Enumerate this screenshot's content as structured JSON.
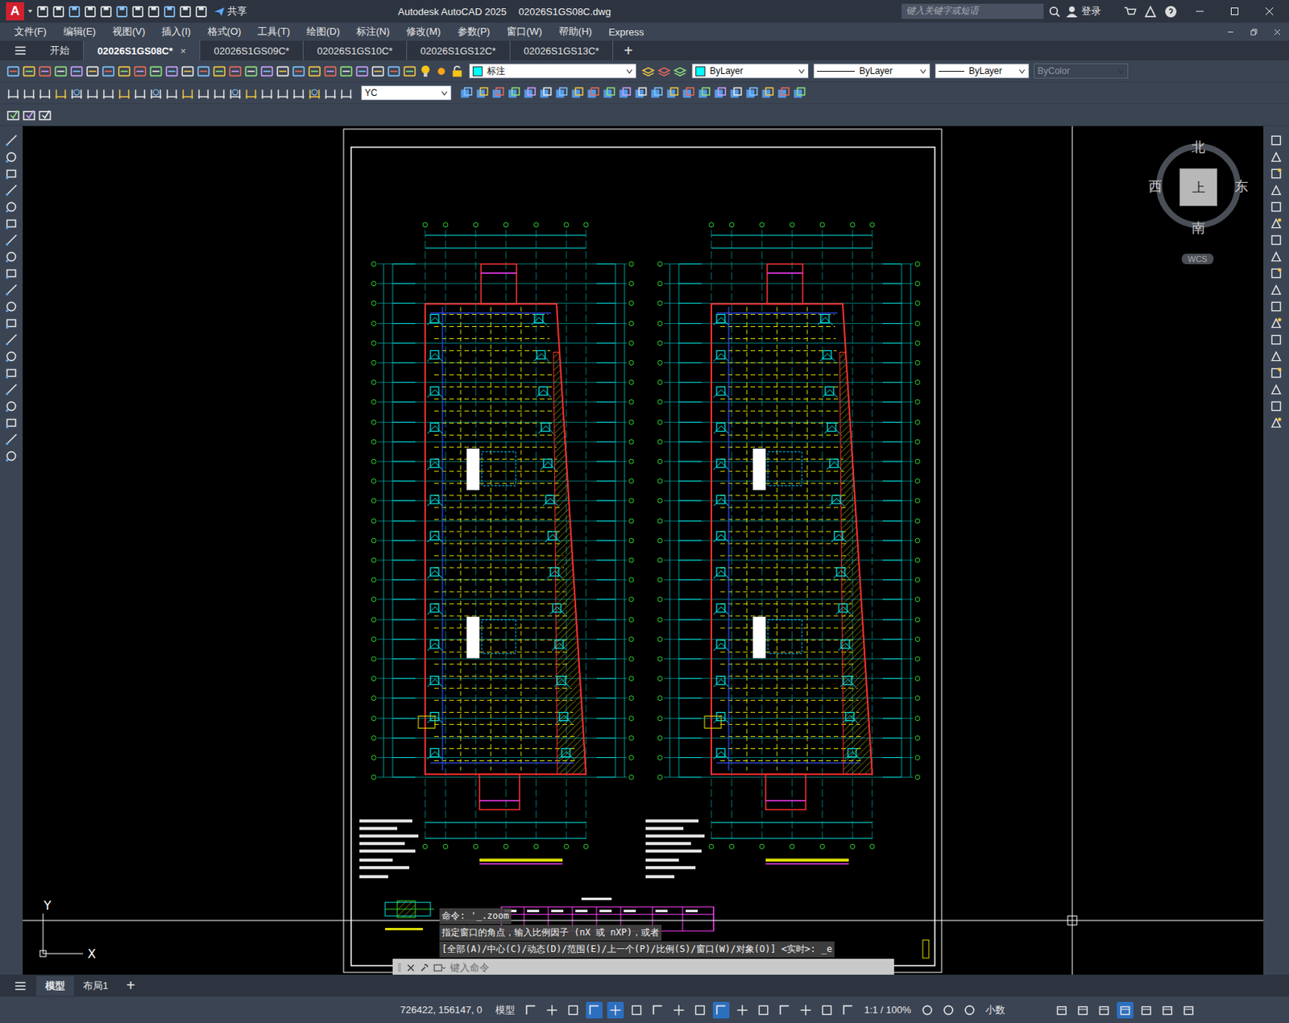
{
  "window": {
    "app_letter": "A",
    "share": "共享",
    "app_name": "Autodesk AutoCAD 2025",
    "file_name": "02026S1GS08C.dwg",
    "search_placeholder": "键入关键字或短语",
    "login": "登录"
  },
  "menu": [
    "文件(F)",
    "编辑(E)",
    "视图(V)",
    "插入(I)",
    "格式(O)",
    "工具(T)",
    "绘图(D)",
    "标注(N)",
    "修改(M)",
    "参数(P)",
    "窗口(W)",
    "帮助(H)",
    "Express"
  ],
  "file_tabs": [
    {
      "label": "开始",
      "selected": false
    },
    {
      "label": "02026S1GS08C*",
      "selected": true
    },
    {
      "label": "02026S1GS09C*",
      "selected": false
    },
    {
      "label": "02026S1GS10C*",
      "selected": false
    },
    {
      "label": "02026S1GS12C*",
      "selected": false
    },
    {
      "label": "02026S1GS13C*",
      "selected": false
    }
  ],
  "tab_close": "×",
  "new_tab": "+",
  "toolbar": {
    "layer": "标注",
    "color": "ByLayer",
    "linetype": "ByLayer",
    "lineweight": "ByLayer",
    "plot_style": "ByColor",
    "dim_style": "YC"
  },
  "viewcube": {
    "north": "北",
    "south": "南",
    "east": "东",
    "west": "西",
    "top": "上",
    "ucs": "WCS"
  },
  "axis": {
    "x": "X",
    "y": "Y"
  },
  "command_line": {
    "history": [
      "命令: '_.zoom",
      "指定窗口的角点，输入比例因子 (nX 或 nXP)，或者",
      "[全部(A)/中心(C)/动态(D)/范围(E)/上一个(P)/比例(S)/窗口(W)/对象(O)] <实时>: _e"
    ],
    "placeholder": "键入命令"
  },
  "layout_tabs": [
    {
      "label": "模型",
      "selected": true
    },
    {
      "label": "布局1",
      "selected": false
    }
  ],
  "layout_add": "+",
  "status_bar": {
    "coords": "726422, 156147, 0",
    "space": "模型",
    "scale": "1:1 / 100%",
    "units": "小数"
  }
}
